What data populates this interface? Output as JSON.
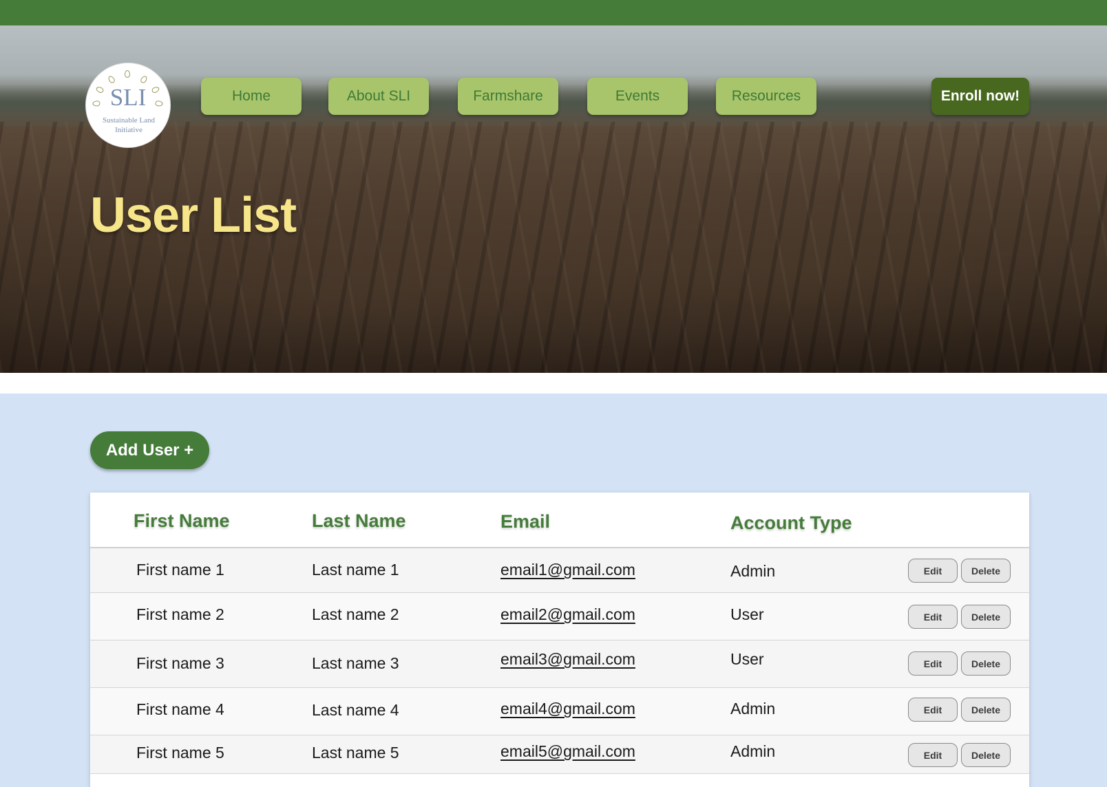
{
  "logo": {
    "mark": "SLI",
    "subtitle": "Sustainable Land Initiative"
  },
  "nav": {
    "home": "Home",
    "about": "About SLI",
    "farmshare": "Farmshare",
    "events": "Events",
    "resources": "Resources",
    "enroll": "Enroll now!"
  },
  "page": {
    "title": "User List",
    "add_user_label": "Add User +"
  },
  "table": {
    "headers": {
      "first": "First Name",
      "last": "Last Name",
      "email": "Email",
      "type": "Account Type"
    },
    "edit_label": "Edit",
    "delete_label": "Delete",
    "rows": [
      {
        "first": "First name 1",
        "last": "Last name 1",
        "email": "email1@gmail.com",
        "type": "Admin"
      },
      {
        "first": "First name 2",
        "last": "Last name 2",
        "email": "email2@gmail.com",
        "type": "User"
      },
      {
        "first": "First name 3",
        "last": "Last name 3",
        "email": "email3@gmail.com",
        "type": "User"
      },
      {
        "first": "First name 4",
        "last": "Last name 4",
        "email": "email4@gmail.com",
        "type": "Admin"
      },
      {
        "first": "First name 5",
        "last": "Last name 5",
        "email": "email5@gmail.com",
        "type": "Admin"
      }
    ]
  },
  "colors": {
    "brand_green": "#457c3a",
    "nav_green": "#a9c56b",
    "enroll_green": "#48681f",
    "title_yellow": "#f7e58a",
    "page_bg": "#d3e2f5"
  }
}
